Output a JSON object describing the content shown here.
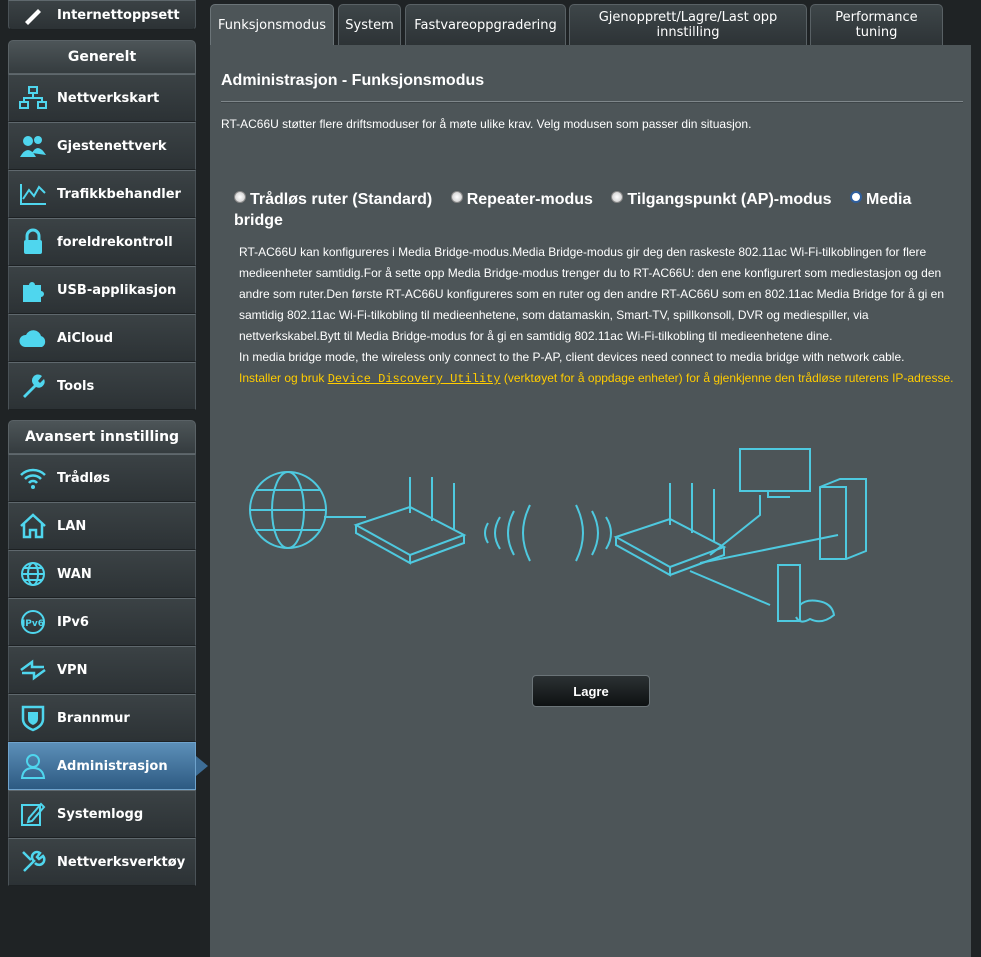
{
  "sidebar": {
    "top_item": {
      "label": "Internettoppsett",
      "icon": "globe-icon"
    },
    "general": {
      "header": "Generelt",
      "items": [
        {
          "label": "Nettverkskart",
          "icon": "network-map-icon"
        },
        {
          "label": "Gjestenettverk",
          "icon": "guest-network-icon"
        },
        {
          "label": "Trafikkbehandler",
          "icon": "traffic-icon"
        },
        {
          "label": "foreldrekontroll",
          "icon": "lock-icon"
        },
        {
          "label": "USB-applikasjon",
          "icon": "puzzle-icon"
        },
        {
          "label": "AiCloud",
          "icon": "cloud-icon"
        },
        {
          "label": "Tools",
          "icon": "wrench-icon"
        }
      ]
    },
    "advanced": {
      "header": "Avansert innstilling",
      "items": [
        {
          "label": "Trådløs",
          "icon": "wifi-icon"
        },
        {
          "label": "LAN",
          "icon": "home-icon"
        },
        {
          "label": "WAN",
          "icon": "globe-icon"
        },
        {
          "label": "IPv6",
          "icon": "ipv6-icon"
        },
        {
          "label": "VPN",
          "icon": "vpn-icon"
        },
        {
          "label": "Brannmur",
          "icon": "shield-icon"
        },
        {
          "label": "Administrasjon",
          "icon": "admin-user-icon",
          "active": true
        },
        {
          "label": "Systemlogg",
          "icon": "log-edit-icon"
        },
        {
          "label": "Nettverksverktøy",
          "icon": "tools-icon"
        }
      ]
    }
  },
  "tabs": [
    {
      "label": "Funksjonsmodus",
      "active": true
    },
    {
      "label": "System"
    },
    {
      "label": "Fastvareoppgradering"
    },
    {
      "label": "Gjenopprett/Lagre/Last opp innstilling"
    },
    {
      "label": "Performance tuning"
    }
  ],
  "page": {
    "title": "Administrasjon - Funksjonsmodus",
    "intro": "RT-AC66U støtter flere driftsmoduser for å møte ulike krav. Velg modusen som passer din situasjon.",
    "modes": [
      {
        "label": "Trådløs ruter (Standard)",
        "selected": false
      },
      {
        "label": "Repeater-modus",
        "selected": false
      },
      {
        "label": "Tilgangspunkt (AP)-modus",
        "selected": false
      },
      {
        "label": "Media bridge",
        "selected": true
      }
    ],
    "description": "RT-AC66U kan konfigureres i Media Bridge-modus.Media Bridge-modus gir deg den raskeste 802.11ac Wi-Fi-tilkoblingen for flere medieenheter samtidig.For å sette opp Media Bridge-modus trenger du to RT-AC66U: den ene konfigurert som mediestasjon og den andre som ruter.Den første RT-AC66U konfigureres som en ruter og den andre RT-AC66U som en 802.11ac Media Bridge for å gi en samtidig 802.11ac Wi-Fi-tilkobling til medieenhetene, som datamaskin, Smart-TV, spillkonsoll, DVR og mediespiller, via nettverkskabel.Bytt til Media Bridge-modus for å gi en samtidig 802.11ac Wi-Fi-tilkobling til medieenhetene dine.",
    "note": "In media bridge mode, the wireless only connect to the P-AP, client devices need connect to media bridge with network cable.",
    "install_prefix": "Installer og bruk ",
    "install_link": "Device Discovery Utility",
    "install_suffix": " (verktøyet for å oppdage enheter) for å gjenkjenne den trådløse ruterens IP-adresse.",
    "save_label": "Lagre"
  },
  "colors": {
    "accent": "#4fd6ee",
    "link": "#ffcc00",
    "active": "#3d6d96"
  }
}
